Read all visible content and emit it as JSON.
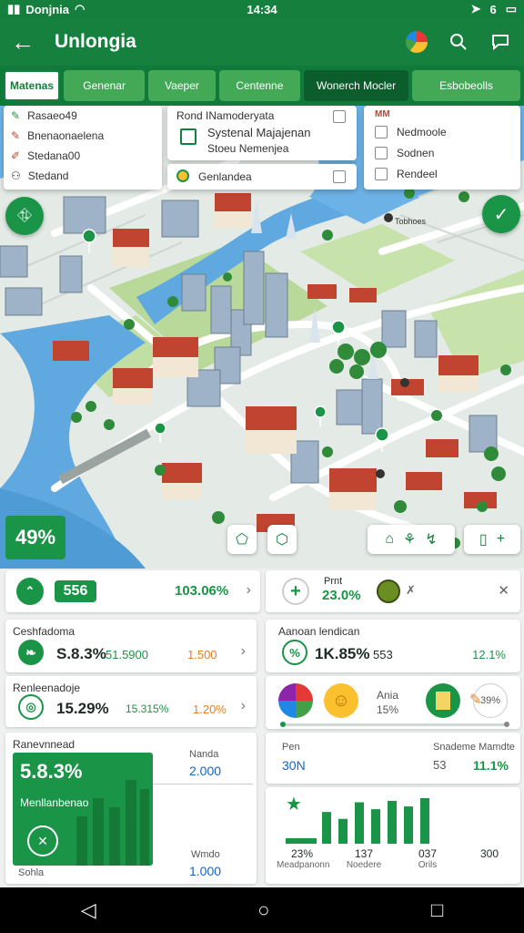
{
  "status": {
    "carrier": "Donjnia",
    "clock": "14:34",
    "battery": "6"
  },
  "appbar": {
    "title": "Unlongia"
  },
  "tabs": [
    "Matenas",
    "Genenar",
    "Vaeper",
    "Centenne",
    "Wonerch Mocler",
    "Esbobeolls"
  ],
  "popup_left": {
    "items": [
      "Rasaeo49",
      "Bnenaonaelena",
      "Stedana00",
      "Stedand"
    ]
  },
  "popup_mid": {
    "header": "Rond INamoderyata",
    "line1": "Systenal Majajenan",
    "line2": "Stoeu Nemenjea",
    "footer": "Genlandea"
  },
  "popup_right": {
    "header": "MM",
    "items": [
      "Nedmoole",
      "Sodnen",
      "Rendeel"
    ]
  },
  "map": {
    "label_a": "Tobhoes",
    "percent_badge": "49%"
  },
  "summary": {
    "value1": "556",
    "value2": "103.06%",
    "value3": "23.0%",
    "label_top": "Prnt"
  },
  "card_a": {
    "title": "Ceshfadoma",
    "v1": "S.8.3%",
    "v2": "51.5900",
    "v3": "1.500"
  },
  "card_b": {
    "title": "Renleenadoje",
    "v1": "15.29%",
    "v2": "15.315%",
    "v3": "1.20%"
  },
  "card_c": {
    "title": "Ranevnnead",
    "hdr": "Nanda",
    "v1": "5.8.3%",
    "v2": "2.000",
    "label": "Menllanbenao",
    "bottom_left": "Sohla",
    "bottom_hdr": "Wmdo",
    "bottom_val": "1.000"
  },
  "card_d": {
    "title": "Aanoan lendican",
    "v1": "1K.85%",
    "v2": "553",
    "v3": "12.1%"
  },
  "card_e": {
    "text1": "Ania",
    "text2": "15%",
    "text3": "39%"
  },
  "card_f": {
    "left_lbl": "Pen",
    "left_val": "30N",
    "right_lbl": "Snademe Mamdte",
    "right_v1": "53",
    "right_v2": "11.1%"
  },
  "card_g": {
    "stats": [
      {
        "value": "23%",
        "label": "Meadpanonn"
      },
      {
        "value": "137",
        "label": "Noedere"
      },
      {
        "value": "037",
        "label": "Orils"
      },
      {
        "value": "300",
        "label": ""
      }
    ]
  },
  "chart_data": {
    "type": "bar",
    "values": [
      8,
      46,
      36,
      60,
      50,
      62,
      54,
      66
    ]
  },
  "colors": {
    "primary": "#16803e",
    "accent": "#1a9447",
    "orange": "#e67e22"
  }
}
